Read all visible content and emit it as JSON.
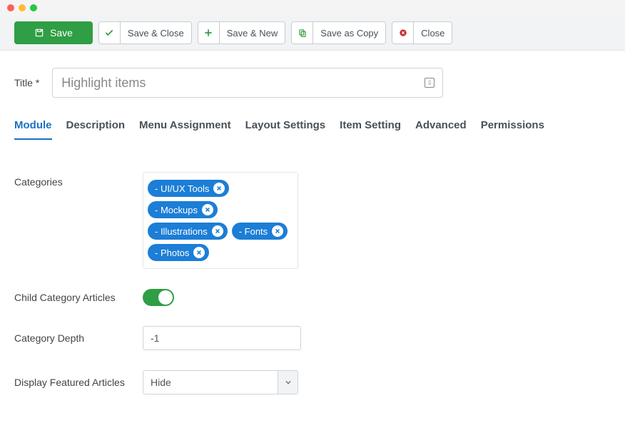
{
  "toolbar": {
    "save": "Save",
    "save_close": "Save & Close",
    "save_new": "Save & New",
    "save_copy": "Save as Copy",
    "close": "Close"
  },
  "title": {
    "label": "Title *",
    "value": "Highlight items"
  },
  "tabs": [
    {
      "id": "module",
      "label": "Module",
      "active": true
    },
    {
      "id": "description",
      "label": "Description"
    },
    {
      "id": "menu-assignment",
      "label": "Menu Assignment"
    },
    {
      "id": "layout-settings",
      "label": "Layout Settings"
    },
    {
      "id": "item-setting",
      "label": "Item Setting"
    },
    {
      "id": "advanced",
      "label": "Advanced"
    },
    {
      "id": "permissions",
      "label": "Permissions"
    }
  ],
  "form": {
    "categories_label": "Categories",
    "categories": [
      "- UI/UX Tools",
      "- Mockups",
      "- Illustrations",
      "- Fonts",
      "- Photos"
    ],
    "child_articles_label": "Child Category Articles",
    "child_articles_on": true,
    "category_depth_label": "Category Depth",
    "category_depth_value": "-1",
    "display_featured_label": "Display Featured Articles",
    "display_featured_value": "Hide"
  }
}
